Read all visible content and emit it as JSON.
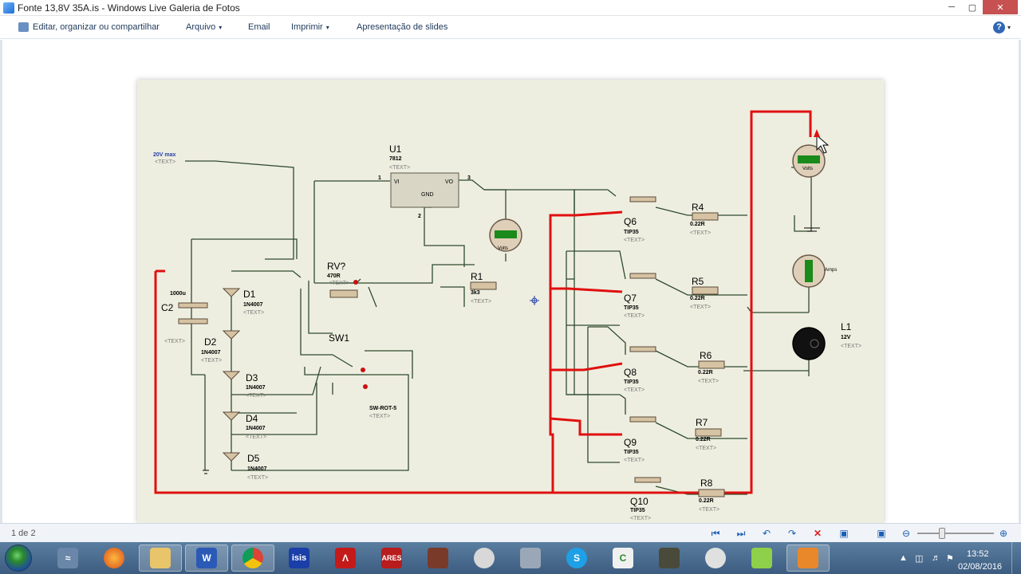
{
  "window": {
    "title": "Fonte  13,8V 35A.is - Windows Live Galeria de Fotos",
    "minimize_icon": "minimize-icon",
    "maximize_icon": "maximize-icon",
    "close_icon": "close-icon"
  },
  "commandbar": {
    "edit": "Editar, organizar ou compartilhar",
    "file": "Arquivo",
    "email": "Email",
    "print": "Imprimir",
    "slideshow": "Apresentação de slides",
    "dropdown_glyph": "▾",
    "help_glyph": "?"
  },
  "schematic": {
    "source_label": "20V max",
    "text_tag": "<TEXT>",
    "u1": {
      "name": "U1",
      "part": "7812",
      "pin_vi": "VI",
      "pin_vo": "VO",
      "pin_gnd": "GND",
      "pin1": "1",
      "pin2": "2",
      "pin3": "3"
    },
    "c2": {
      "name": "C2",
      "value": "1000u"
    },
    "rv": {
      "name": "RV?",
      "value": "470R"
    },
    "r1": {
      "name": "R1",
      "value": "3k3"
    },
    "sw1": {
      "name": "SW1",
      "part": "SW-ROT-5"
    },
    "diodes": [
      {
        "name": "D1",
        "part": "1N4007"
      },
      {
        "name": "D2",
        "part": "1N4007"
      },
      {
        "name": "D3",
        "part": "1N4007"
      },
      {
        "name": "D4",
        "part": "1N4007"
      },
      {
        "name": "D5",
        "part": "1N4007"
      }
    ],
    "transistors": [
      {
        "name": "Q6",
        "part": "TIP35"
      },
      {
        "name": "Q7",
        "part": "TIP35"
      },
      {
        "name": "Q8",
        "part": "TIP35"
      },
      {
        "name": "Q9",
        "part": "TIP35"
      },
      {
        "name": "Q10",
        "part": "TIP35"
      }
    ],
    "resistors": [
      {
        "name": "R4",
        "value": "0.22R"
      },
      {
        "name": "R5",
        "value": "0.22R"
      },
      {
        "name": "R6",
        "value": "0.22R"
      },
      {
        "name": "R7",
        "value": "0.22R"
      },
      {
        "name": "R8",
        "value": "0.22R"
      }
    ],
    "lamp": {
      "name": "L1",
      "value": "12V"
    },
    "meter_volts": "Volts",
    "meter_amps": "Amps"
  },
  "navigation": {
    "page_counter": "1 de 2",
    "icons": [
      "first-icon",
      "next-icon",
      "rotate-left-icon",
      "rotate-right-icon",
      "delete-icon",
      "slideshow-icon",
      "actual-size-icon",
      "zoom-out-icon",
      "zoom-in-icon"
    ],
    "zoom_level": 0.33
  },
  "taskbar": {
    "apps": [
      "Windows",
      "Firefox",
      "Explorer",
      "Word",
      "Chrome",
      "ISIS",
      "PDF",
      "ARES",
      "Book",
      "Paint",
      "Calculator",
      "Skype",
      "Camtasia",
      "Media",
      "Webcam",
      "Battery",
      "Galeria"
    ],
    "time": "13:52",
    "date": "02/08/2016"
  }
}
